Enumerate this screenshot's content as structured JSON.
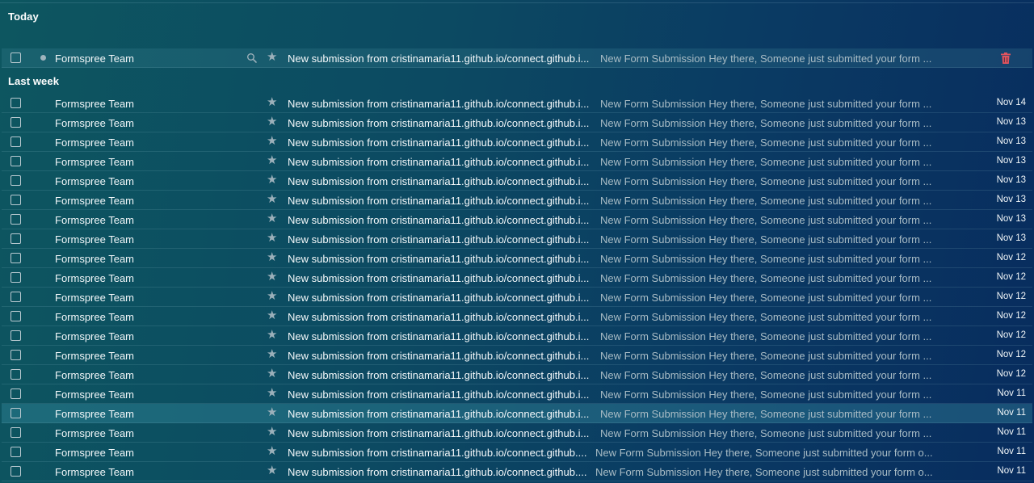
{
  "sections": {
    "today": "Today",
    "last_week": "Last week"
  },
  "today_row": {
    "sender": "Formspree Team",
    "subject": "New submission from cristinamaria11.github.io/connect.github.i...",
    "snippet": "New Form Submission Hey there, Someone just submitted your form ..."
  },
  "rows": [
    {
      "sender": "Formspree Team",
      "subject": "New submission from cristinamaria11.github.io/connect.github.i...",
      "snippet": "New Form Submission Hey there, Someone just submitted your form ...",
      "date": "Nov 14"
    },
    {
      "sender": "Formspree Team",
      "subject": "New submission from cristinamaria11.github.io/connect.github.i...",
      "snippet": "New Form Submission Hey there, Someone just submitted your form ...",
      "date": "Nov 13"
    },
    {
      "sender": "Formspree Team",
      "subject": "New submission from cristinamaria11.github.io/connect.github.i...",
      "snippet": "New Form Submission Hey there, Someone just submitted your form ...",
      "date": "Nov 13"
    },
    {
      "sender": "Formspree Team",
      "subject": "New submission from cristinamaria11.github.io/connect.github.i...",
      "snippet": "New Form Submission Hey there, Someone just submitted your form ...",
      "date": "Nov 13"
    },
    {
      "sender": "Formspree Team",
      "subject": "New submission from cristinamaria11.github.io/connect.github.i...",
      "snippet": "New Form Submission Hey there, Someone just submitted your form ...",
      "date": "Nov 13"
    },
    {
      "sender": "Formspree Team",
      "subject": "New submission from cristinamaria11.github.io/connect.github.i...",
      "snippet": "New Form Submission Hey there, Someone just submitted your form ...",
      "date": "Nov 13"
    },
    {
      "sender": "Formspree Team",
      "subject": "New submission from cristinamaria11.github.io/connect.github.i...",
      "snippet": "New Form Submission Hey there, Someone just submitted your form ...",
      "date": "Nov 13"
    },
    {
      "sender": "Formspree Team",
      "subject": "New submission from cristinamaria11.github.io/connect.github.i...",
      "snippet": "New Form Submission Hey there, Someone just submitted your form ...",
      "date": "Nov 13"
    },
    {
      "sender": "Formspree Team",
      "subject": "New submission from cristinamaria11.github.io/connect.github.i...",
      "snippet": "New Form Submission Hey there, Someone just submitted your form ...",
      "date": "Nov 12"
    },
    {
      "sender": "Formspree Team",
      "subject": "New submission from cristinamaria11.github.io/connect.github.i...",
      "snippet": "New Form Submission Hey there, Someone just submitted your form ...",
      "date": "Nov 12"
    },
    {
      "sender": "Formspree Team",
      "subject": "New submission from cristinamaria11.github.io/connect.github.i...",
      "snippet": "New Form Submission Hey there, Someone just submitted your form ...",
      "date": "Nov 12"
    },
    {
      "sender": "Formspree Team",
      "subject": "New submission from cristinamaria11.github.io/connect.github.i...",
      "snippet": "New Form Submission Hey there, Someone just submitted your form ...",
      "date": "Nov 12"
    },
    {
      "sender": "Formspree Team",
      "subject": "New submission from cristinamaria11.github.io/connect.github.i...",
      "snippet": "New Form Submission Hey there, Someone just submitted your form ...",
      "date": "Nov 12"
    },
    {
      "sender": "Formspree Team",
      "subject": "New submission from cristinamaria11.github.io/connect.github.i...",
      "snippet": "New Form Submission Hey there, Someone just submitted your form ...",
      "date": "Nov 12"
    },
    {
      "sender": "Formspree Team",
      "subject": "New submission from cristinamaria11.github.io/connect.github.i...",
      "snippet": "New Form Submission Hey there, Someone just submitted your form ...",
      "date": "Nov 12"
    },
    {
      "sender": "Formspree Team",
      "subject": "New submission from cristinamaria11.github.io/connect.github.i...",
      "snippet": "New Form Submission Hey there, Someone just submitted your form ...",
      "date": "Nov 11"
    },
    {
      "sender": "Formspree Team",
      "subject": "New submission from cristinamaria11.github.io/connect.github.i...",
      "snippet": "New Form Submission Hey there, Someone just submitted your form ...",
      "date": "Nov 11"
    },
    {
      "sender": "Formspree Team",
      "subject": "New submission from cristinamaria11.github.io/connect.github.i...",
      "snippet": "New Form Submission Hey there, Someone just submitted your form ...",
      "date": "Nov 11"
    },
    {
      "sender": "Formspree Team",
      "subject": "New submission from cristinamaria11.github.io/connect.github....",
      "snippet": "New Form Submission Hey there, Someone just submitted your form o...",
      "date": "Nov 11"
    },
    {
      "sender": "Formspree Team",
      "subject": "New submission from cristinamaria11.github.io/connect.github....",
      "snippet": "New Form Submission Hey there, Someone just submitted your form o...",
      "date": "Nov 11"
    }
  ],
  "icons": {
    "star": "star-icon",
    "search": "search-icon",
    "delete": "trash-icon",
    "unread": "unread-dot-icon"
  },
  "colors": {
    "delete_icon": "#e0545f"
  }
}
